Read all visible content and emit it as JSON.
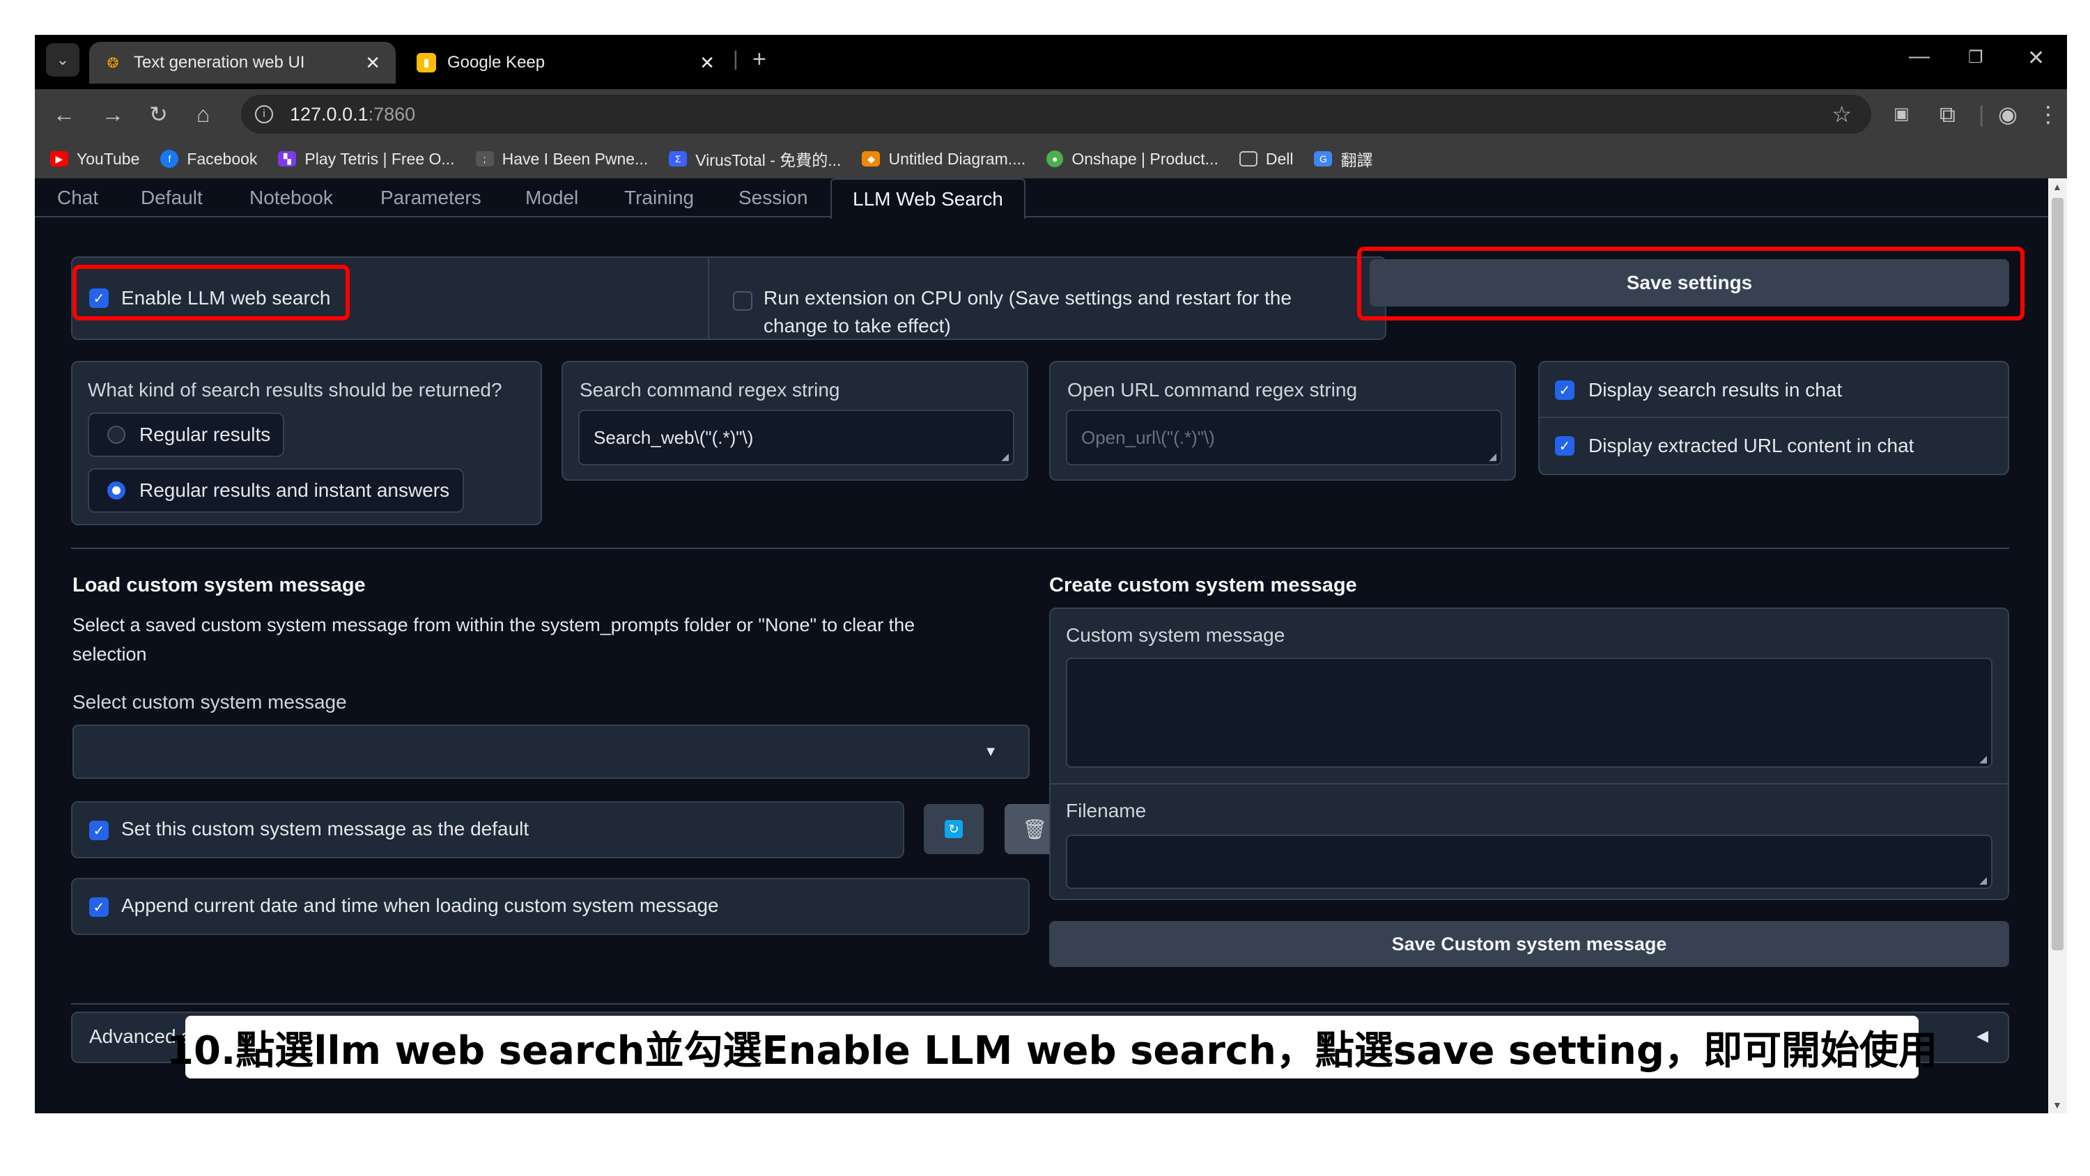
{
  "browser": {
    "tabs": [
      {
        "title": "Text generation web UI",
        "active": true
      },
      {
        "title": "Google Keep",
        "active": false
      }
    ],
    "new_tab": "+",
    "url_host": "127.0.0.1",
    "url_port": ":7860",
    "bookmarks": [
      {
        "label": "YouTube",
        "icon": "youtube-icon",
        "color": "#ff0000"
      },
      {
        "label": "Facebook",
        "icon": "facebook-icon",
        "color": "#1877f2"
      },
      {
        "label": "Play Tetris | Free O...",
        "icon": "tetris-icon",
        "color": "#7c3aed"
      },
      {
        "label": "Have I Been Pwne...",
        "icon": "hibp-icon",
        "color": "#555555"
      },
      {
        "label": "VirusTotal - 免費的...",
        "icon": "virustotal-icon",
        "color": "#3b61ff"
      },
      {
        "label": "Untitled Diagram....",
        "icon": "drawio-icon",
        "color": "#f08705"
      },
      {
        "label": "Onshape | Product...",
        "icon": "onshape-icon",
        "color": "#4caf50"
      },
      {
        "label": "Dell",
        "icon": "folder-icon",
        "color": "#9aa0a6"
      },
      {
        "label": "翻譯",
        "icon": "translate-icon",
        "color": "#4285f4"
      }
    ]
  },
  "app": {
    "tabs": [
      "Chat",
      "Default",
      "Notebook",
      "Parameters",
      "Model",
      "Training",
      "Session",
      "LLM Web Search"
    ],
    "selected_tab": "LLM Web Search",
    "enable_label": "Enable LLM web search",
    "enable_checked": true,
    "cpu_label_line1": "Run extension on CPU only (Save settings and restart for the",
    "cpu_label_line2": "change to take effect)",
    "cpu_checked": false,
    "save_settings": "Save settings",
    "search_kind_label": "What kind of search results should be returned?",
    "search_kind_options": [
      "Regular results",
      "Regular results and instant answers"
    ],
    "search_kind_selected": "Regular results and instant answers",
    "search_regex_label": "Search command regex string",
    "search_regex_value": "Search_web\\(\"(.*)\"\\)",
    "open_url_label": "Open URL command regex string",
    "open_url_placeholder": "Open_url\\(\"(.*)\"\\)",
    "display_results_label": "Display search results in chat",
    "display_results_checked": true,
    "display_url_label": "Display extracted URL content in chat",
    "display_url_checked": true,
    "load_heading": "Load custom system message",
    "load_desc_line1": "Select a saved custom system message from within the system_prompts folder or \"None\" to clear the",
    "load_desc_line2": "selection",
    "select_label": "Select custom system message",
    "select_value": "",
    "default_label": "Set this custom system message as the default",
    "default_checked": true,
    "append_label": "Append current date and time when loading custom system message",
    "append_checked": true,
    "create_heading": "Create custom system message",
    "custom_msg_label": "Custom system message",
    "custom_msg_value": "",
    "filename_label": "Filename",
    "filename_value": "",
    "save_custom": "Save Custom system message",
    "advanced_label": "Advanced s"
  },
  "caption": "10.點選llm web search並勾選Enable LLM web search，點選save setting，即可開始使用",
  "colors": {
    "accent": "#2563eb",
    "highlight": "#ff0000",
    "panel": "#1f2937",
    "bg": "#0b0f19"
  }
}
